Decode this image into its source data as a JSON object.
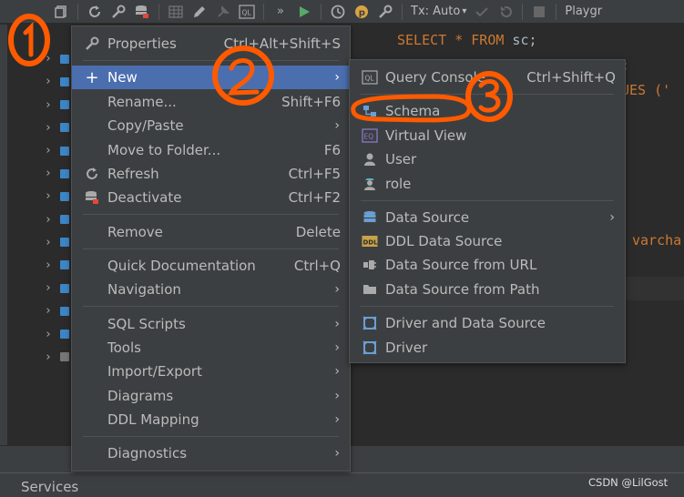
{
  "toolbar": {
    "tx_label": "Tx: Auto",
    "playground_label": "Playgr"
  },
  "editor": {
    "line1": {
      "kw1": "SELECT",
      "star": " * ",
      "kw2": "FROM",
      "ident": " sc;"
    },
    "line2_tail": ";",
    "line3_tail": "UES ('",
    "line4_tail": "varcha"
  },
  "menu1": {
    "items": [
      {
        "label": "Properties",
        "shortcut": "Ctrl+Alt+Shift+S"
      },
      {
        "label": "New",
        "shortcut": ""
      },
      {
        "label": "Rename...",
        "shortcut": "Shift+F6"
      },
      {
        "label": "Copy/Paste",
        "shortcut": ""
      },
      {
        "label": "Move to Folder...",
        "shortcut": "F6"
      },
      {
        "label": "Refresh",
        "shortcut": "Ctrl+F5"
      },
      {
        "label": "Deactivate",
        "shortcut": "Ctrl+F2"
      },
      {
        "label": "Remove",
        "shortcut": "Delete"
      },
      {
        "label": "Quick Documentation",
        "shortcut": "Ctrl+Q"
      },
      {
        "label": "Navigation",
        "shortcut": ""
      },
      {
        "label": "SQL Scripts",
        "shortcut": ""
      },
      {
        "label": "Tools",
        "shortcut": ""
      },
      {
        "label": "Import/Export",
        "shortcut": ""
      },
      {
        "label": "Diagrams",
        "shortcut": ""
      },
      {
        "label": "DDL Mapping",
        "shortcut": ""
      },
      {
        "label": "Diagnostics",
        "shortcut": ""
      }
    ]
  },
  "menu2": {
    "items": [
      {
        "label": "Query Console",
        "shortcut": "Ctrl+Shift+Q"
      },
      {
        "label": "Schema"
      },
      {
        "label": "Virtual View"
      },
      {
        "label": "User"
      },
      {
        "label": "role"
      },
      {
        "label": "Data Source"
      },
      {
        "label": "DDL Data Source"
      },
      {
        "label": "Data Source from URL"
      },
      {
        "label": "Data Source from Path"
      },
      {
        "label": "Driver and Data Source"
      },
      {
        "label": "Driver"
      }
    ]
  },
  "services_label": "Services",
  "watermark": "CSDN @LilGost",
  "colors": {
    "selection": "#4b6eaf",
    "menu_bg": "#3c3f41",
    "editor_bg": "#2b2b2b",
    "keyword": "#cc7832",
    "annotation": "#ff5a00"
  }
}
